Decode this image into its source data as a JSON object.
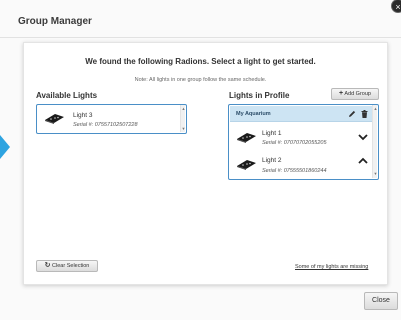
{
  "dialog": {
    "title": "Group Manager",
    "close_glyph": "×",
    "headline": "We found the following Radions. Select a light to get started.",
    "note": "Note: All lights in one group follow the same schedule."
  },
  "available": {
    "title": "Available Lights",
    "lights": [
      {
        "name": "Light 3",
        "serial": "Serial #: 07557102507228"
      }
    ]
  },
  "profile": {
    "title": "Lights in Profile",
    "add_group_label": "Add Group",
    "group_name": "My Aquarium",
    "lights": [
      {
        "name": "Light 1",
        "serial": "Serial #: 07070702055205"
      },
      {
        "name": "Light 2",
        "serial": "Serial #: 07555501860244"
      }
    ]
  },
  "footer": {
    "clear_label": "Clear Selection",
    "missing_link": "Some of my lights are missing",
    "close_label": "Close"
  },
  "colors": {
    "accent_blue": "#4a8fc7",
    "arrow_blue": "#2da3e0",
    "group_header": "#cde4f3"
  },
  "icons": [
    "close-icon",
    "plus-icon",
    "pencil-icon",
    "trash-icon",
    "chevron-down-icon",
    "chevron-up-icon",
    "refresh-icon",
    "radion-light-icon"
  ]
}
